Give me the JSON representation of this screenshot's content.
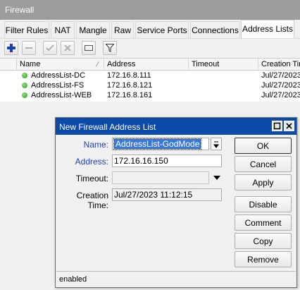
{
  "window": {
    "title": "Firewall"
  },
  "tabs": [
    {
      "label": "Filter Rules"
    },
    {
      "label": "NAT"
    },
    {
      "label": "Mangle"
    },
    {
      "label": "Raw"
    },
    {
      "label": "Service Ports"
    },
    {
      "label": "Connections"
    },
    {
      "label": "Address Lists",
      "active": true
    }
  ],
  "toolbar": {
    "icons": [
      "add-icon",
      "remove-icon",
      "enable-icon",
      "disable-icon",
      "comment-icon",
      "filter-icon"
    ]
  },
  "table": {
    "columns": [
      "Name",
      "Address",
      "Timeout",
      "Creation Time"
    ],
    "rows": [
      {
        "name": "AddressList-DC",
        "address": "172.16.8.111",
        "timeout": "",
        "creation": "Jul/27/2023"
      },
      {
        "name": "AddressList-FS",
        "address": "172.16.8.121",
        "timeout": "",
        "creation": "Jul/27/2023"
      },
      {
        "name": "AddressList-WEB",
        "address": "172.16.8.161",
        "timeout": "",
        "creation": "Jul/27/2023"
      }
    ]
  },
  "dialog": {
    "title": "New Firewall Address List",
    "fields": {
      "name_label": "Name:",
      "name_value": "AddressList-GodMode",
      "address_label": "Address:",
      "address_value": "172.16.16.150",
      "timeout_label": "Timeout:",
      "timeout_value": "",
      "creation_label": "Creation Time:",
      "creation_value": "Jul/27/2023 11:12:15"
    },
    "buttons": {
      "ok": "OK",
      "cancel": "Cancel",
      "apply": "Apply",
      "disable": "Disable",
      "comment": "Comment",
      "copy": "Copy",
      "remove": "Remove"
    },
    "status": "enabled"
  },
  "colors": {
    "dialog_title_bg": "#0b4aa6",
    "label_blue": "#1f3fbf",
    "selection": "#3a77d6",
    "status_dot": "#2a9a1c"
  }
}
